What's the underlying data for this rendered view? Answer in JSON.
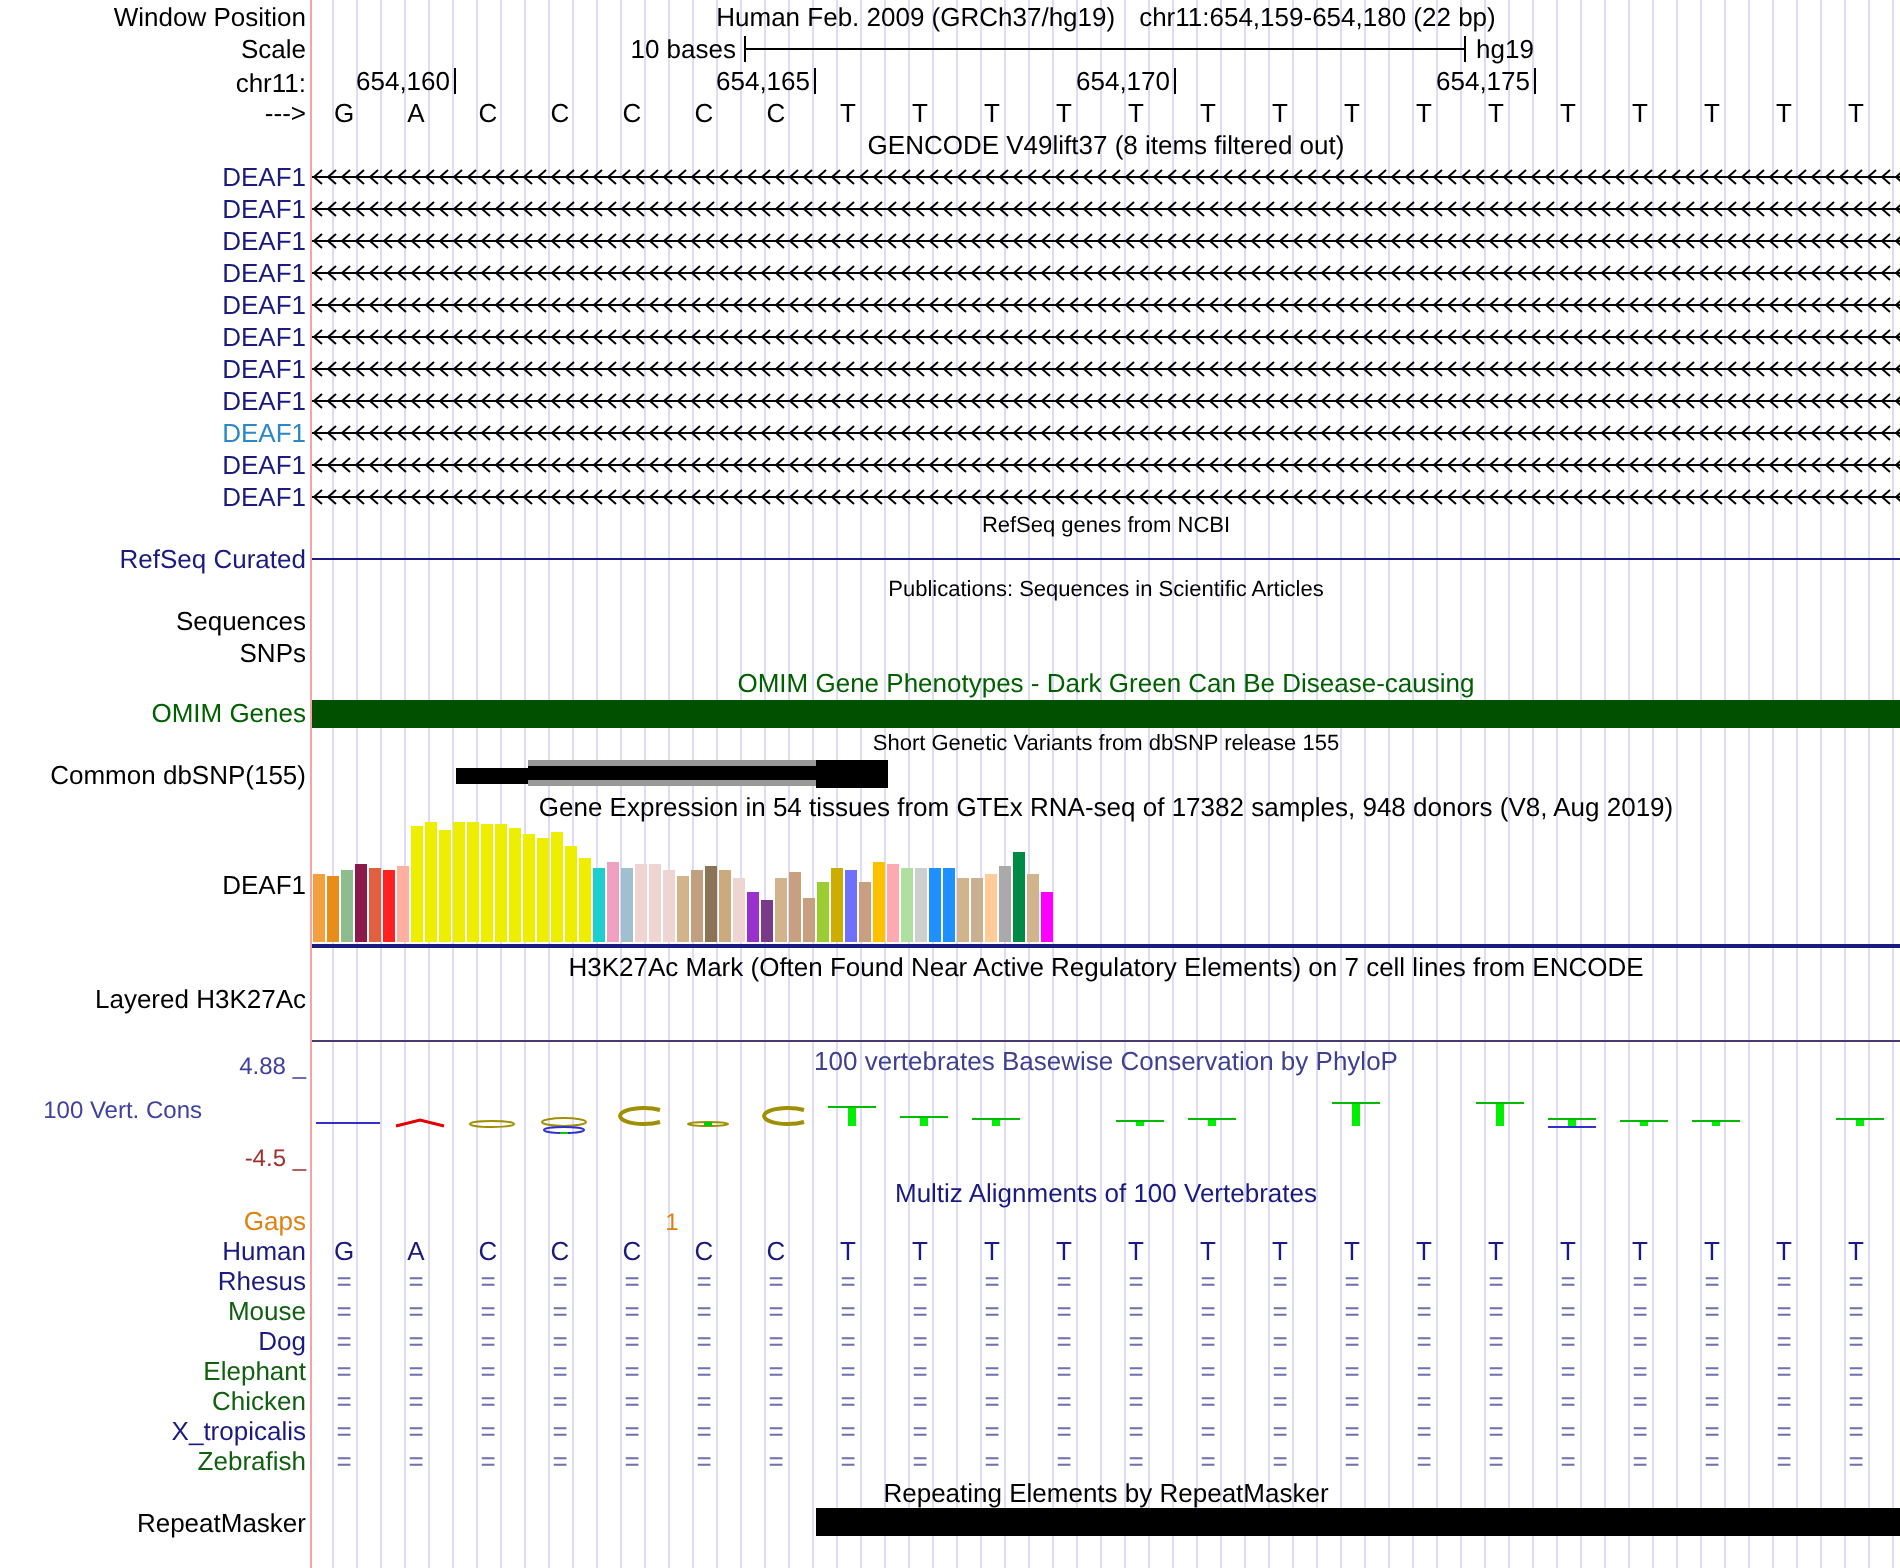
{
  "window_position": {
    "label": "Window Position",
    "assembly": "Human Feb. 2009 (GRCh37/hg19)",
    "region": "chr11:654,159-654,180 (22 bp)"
  },
  "scale": {
    "label": "Scale",
    "span": "10 bases",
    "assembly": "hg19"
  },
  "ruler": {
    "label": "chr11:",
    "ticks": [
      "654,160",
      "654,165",
      "654,170",
      "654,175"
    ]
  },
  "sequence": {
    "label": "--->",
    "bases": [
      "G",
      "A",
      "C",
      "C",
      "C",
      "C",
      "C",
      "T",
      "T",
      "T",
      "T",
      "T",
      "T",
      "T",
      "T",
      "T",
      "T",
      "T",
      "T",
      "T",
      "T",
      "T"
    ]
  },
  "gencode": {
    "title": "GENCODE V49lift37 (8 items filtered out)",
    "items": [
      {
        "name": "DEAF1",
        "selected": false
      },
      {
        "name": "DEAF1",
        "selected": false
      },
      {
        "name": "DEAF1",
        "selected": false
      },
      {
        "name": "DEAF1",
        "selected": false
      },
      {
        "name": "DEAF1",
        "selected": false
      },
      {
        "name": "DEAF1",
        "selected": false
      },
      {
        "name": "DEAF1",
        "selected": false
      },
      {
        "name": "DEAF1",
        "selected": false
      },
      {
        "name": "DEAF1",
        "selected": true
      },
      {
        "name": "DEAF1",
        "selected": false
      },
      {
        "name": "DEAF1",
        "selected": false
      }
    ]
  },
  "refseq": {
    "title": "RefSeq genes from NCBI",
    "label": "RefSeq Curated"
  },
  "publications": {
    "title": "Publications: Sequences in Scientific Articles",
    "labels": [
      "Sequences",
      "SNPs"
    ]
  },
  "omim": {
    "title": "OMIM Gene Phenotypes - Dark Green Can Be Disease-causing",
    "label": "OMIM Genes"
  },
  "dbsnp": {
    "title": "Short Genetic Variants from dbSNP release 155",
    "label": "Common dbSNP(155)"
  },
  "gtex": {
    "title": "Gene Expression in 54 tissues from GTEx RNA-seq of 17382 samples, 948 donors (V8, Aug 2019)",
    "label": "DEAF1"
  },
  "h3k27ac": {
    "title": "H3K27Ac Mark (Often Found Near Active Regulatory Elements) on 7 cell lines from ENCODE",
    "label": "Layered H3K27Ac"
  },
  "conservation": {
    "title": "100 vertebrates Basewise Conservation by PhyloP",
    "label": "100 Vert. Cons",
    "y_max": "4.88 _",
    "y_min": "-4.5 _"
  },
  "multiz": {
    "title": "Multiz Alignments of 100 Vertebrates",
    "gaps": {
      "label": "Gaps",
      "marks": [
        "1"
      ]
    },
    "species": [
      {
        "name": "Human",
        "color": "#1a1a80",
        "bases": [
          "G",
          "A",
          "C",
          "C",
          "C",
          "C",
          "C",
          "T",
          "T",
          "T",
          "T",
          "T",
          "T",
          "T",
          "T",
          "T",
          "T",
          "T",
          "T",
          "T",
          "T",
          "T"
        ]
      },
      {
        "name": "Rhesus",
        "color": "#1a1a80",
        "bases": [
          "=",
          "=",
          "=",
          "=",
          "=",
          "=",
          "=",
          "=",
          "=",
          "=",
          "=",
          "=",
          "=",
          "=",
          "=",
          "=",
          "=",
          "=",
          "=",
          "=",
          "=",
          "="
        ]
      },
      {
        "name": "Mouse",
        "color": "#106010",
        "bases": [
          "=",
          "=",
          "=",
          "=",
          "=",
          "=",
          "=",
          "=",
          "=",
          "=",
          "=",
          "=",
          "=",
          "=",
          "=",
          "=",
          "=",
          "=",
          "=",
          "=",
          "=",
          "="
        ]
      },
      {
        "name": "Dog",
        "color": "#1a1a80",
        "bases": [
          "=",
          "=",
          "=",
          "=",
          "=",
          "=",
          "=",
          "=",
          "=",
          "=",
          "=",
          "=",
          "=",
          "=",
          "=",
          "=",
          "=",
          "=",
          "=",
          "=",
          "=",
          "="
        ]
      },
      {
        "name": "Elephant",
        "color": "#106010",
        "bases": [
          "=",
          "=",
          "=",
          "=",
          "=",
          "=",
          "=",
          "=",
          "=",
          "=",
          "=",
          "=",
          "=",
          "=",
          "=",
          "=",
          "=",
          "=",
          "=",
          "=",
          "=",
          "="
        ]
      },
      {
        "name": "Chicken",
        "color": "#106010",
        "bases": [
          "=",
          "=",
          "=",
          "=",
          "=",
          "=",
          "=",
          "=",
          "=",
          "=",
          "=",
          "=",
          "=",
          "=",
          "=",
          "=",
          "=",
          "=",
          "=",
          "=",
          "=",
          "="
        ]
      },
      {
        "name": "X_tropicalis",
        "color": "#1a1a80",
        "bases": [
          "=",
          "=",
          "=",
          "=",
          "=",
          "=",
          "=",
          "=",
          "=",
          "=",
          "=",
          "=",
          "=",
          "=",
          "=",
          "=",
          "=",
          "=",
          "=",
          "=",
          "=",
          "="
        ]
      },
      {
        "name": "Zebrafish",
        "color": "#106010",
        "bases": [
          "=",
          "=",
          "=",
          "=",
          "=",
          "=",
          "=",
          "=",
          "=",
          "=",
          "=",
          "=",
          "=",
          "=",
          "=",
          "=",
          "=",
          "=",
          "=",
          "=",
          "=",
          "="
        ]
      }
    ]
  },
  "repeatmasker": {
    "title": "Repeating Elements by RepeatMasker",
    "label": "RepeatMasker"
  }
}
